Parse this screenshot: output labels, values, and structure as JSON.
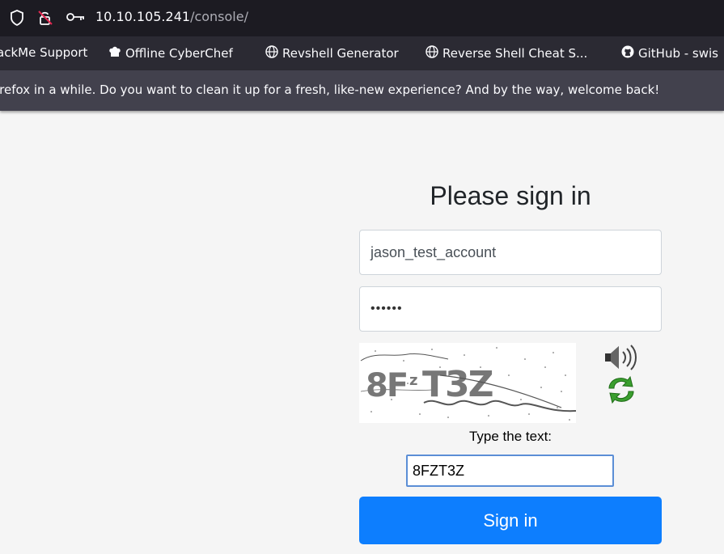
{
  "browser": {
    "url_host": "10.10.105.241",
    "url_path": "/console/",
    "bookmarks": [
      {
        "label": "ackMe Support",
        "icon": "none"
      },
      {
        "label": "Offline CyberChef",
        "icon": "chef-hat-icon"
      },
      {
        "label": "Revshell Generator",
        "icon": "globe-icon"
      },
      {
        "label": "Reverse Shell Cheat S...",
        "icon": "globe-icon"
      },
      {
        "label": "GitHub - swis",
        "icon": "github-icon"
      }
    ],
    "notice": "irefox in a while. Do you want to clean it up for a fresh, like-new experience? And by the way, welcome back!"
  },
  "login": {
    "title": "Please sign in",
    "username_value": "jason_test_account",
    "password_mask": "••••••",
    "captcha_text": "8FzT3Z",
    "captcha_prompt": "Type the text:",
    "captcha_input_value": "8FZT3Z",
    "submit_label": "Sign in"
  },
  "colors": {
    "accent": "#0d7efe",
    "urlbar_bg": "#1c1b22",
    "toolbar_bg": "#2b2a33",
    "notice_bg": "#42414d"
  }
}
